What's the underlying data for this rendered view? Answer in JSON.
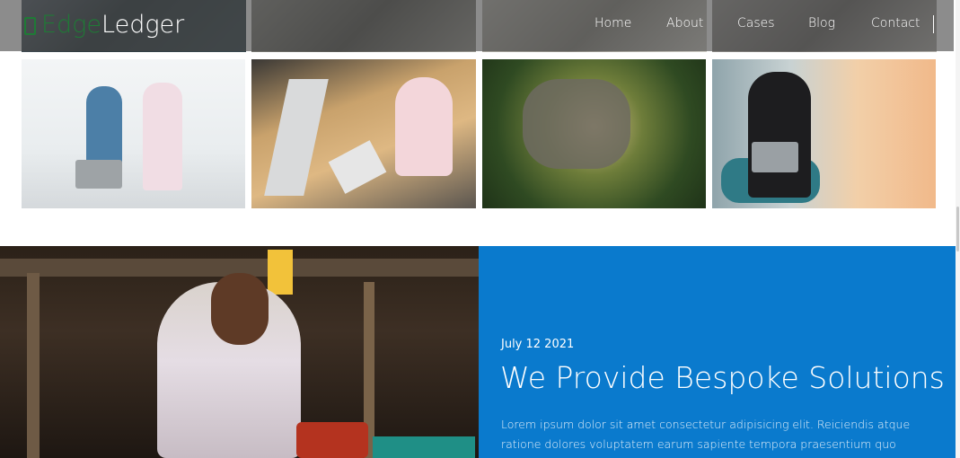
{
  "brand": {
    "name_part1": "Edge",
    "name_part2": "Ledger",
    "icon": "ledger-icon",
    "color_edge": "#1f7a36"
  },
  "nav": {
    "items": [
      {
        "label": "Home"
      },
      {
        "label": "About"
      },
      {
        "label": "Cases"
      },
      {
        "label": "Blog"
      },
      {
        "label": "Contact"
      }
    ]
  },
  "gallery": {
    "images": [
      {
        "alt": "Two men reviewing a laptop at a whiteboard"
      },
      {
        "alt": "Girl writing at a desk with a computer"
      },
      {
        "alt": "Aerial view of a green building complex at night"
      },
      {
        "alt": "Woman smiling at a laptop in a teal chair"
      }
    ]
  },
  "feature": {
    "date": "July 12 2021",
    "title": "We Provide Bespoke Solutions",
    "body": "Lorem ipsum dolor sit amet consectetur adipisicing elit. Reiciendis atque ratione dolores voluptatem earum sapiente tempora praesentium quo maxime harum!",
    "image_alt": "Woman at a market stall with tomatoes",
    "panel_color": "#0a7acd"
  }
}
